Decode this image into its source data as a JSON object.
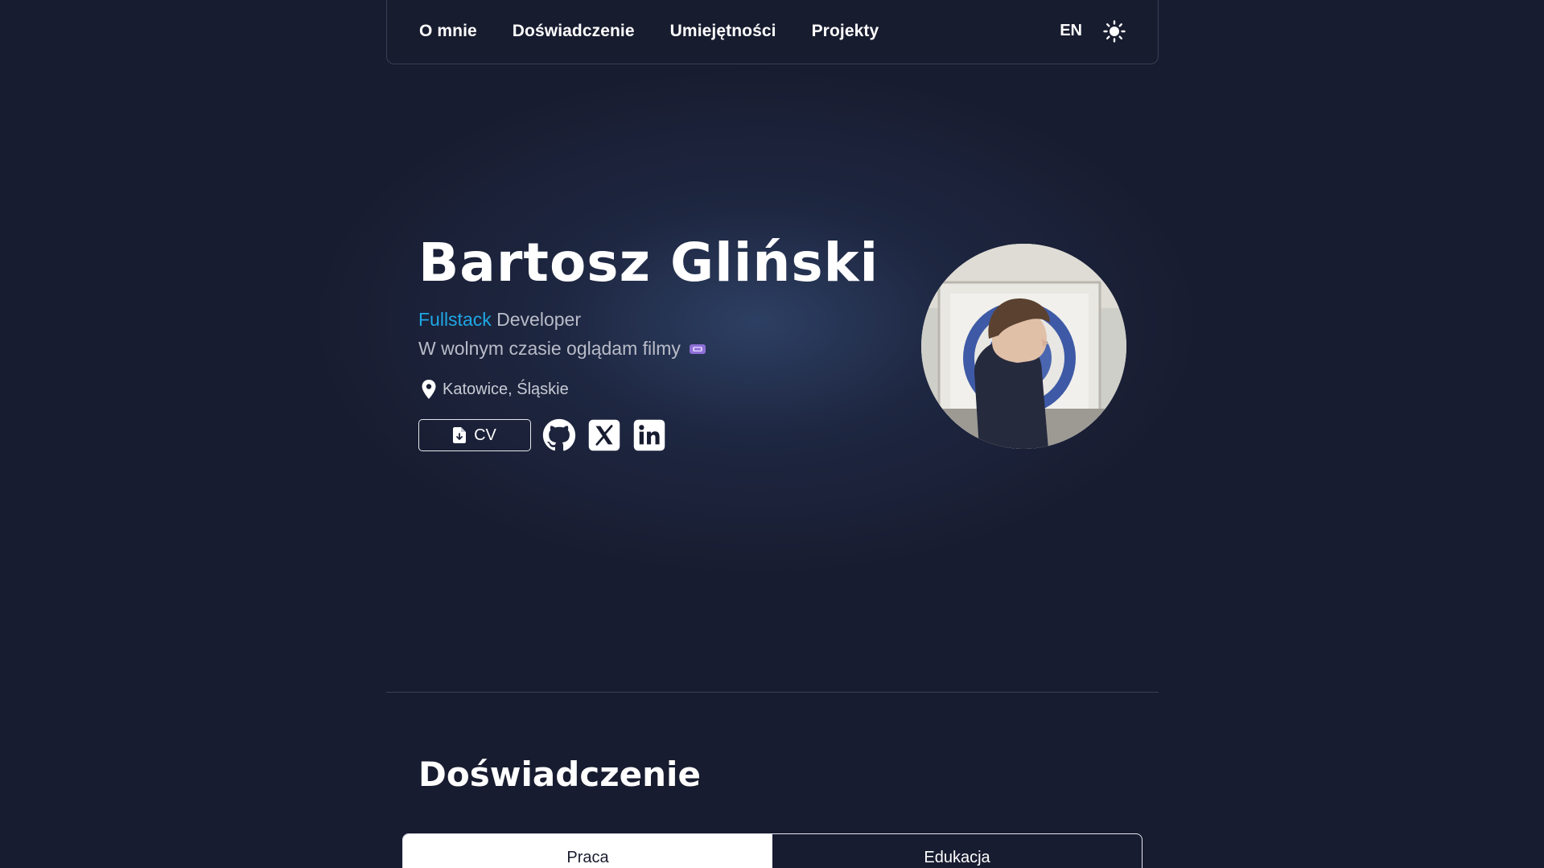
{
  "nav": {
    "links": [
      "O mnie",
      "Doświadczenie",
      "Umiejętności",
      "Projekty"
    ],
    "language": "EN",
    "theme_icon": "sun-icon"
  },
  "hero": {
    "name": "Bartosz Gliński",
    "role_accent": "Fullstack",
    "role_rest": " Developer",
    "hobby": "W wolnym czasie oglądam filmy",
    "hobby_icon": "ticket-icon",
    "location": "Katowice, Śląskie",
    "cv_label": "CV",
    "socials": [
      "github-icon",
      "x-icon",
      "linkedin-icon"
    ]
  },
  "experience": {
    "title": "Doświadczenie",
    "tabs": [
      "Praca",
      "Edukacja"
    ],
    "active_tab": "Praca"
  },
  "colors": {
    "background": "#181c30",
    "accent": "#1ea7e6",
    "muted_text": "#b9bcc8"
  }
}
